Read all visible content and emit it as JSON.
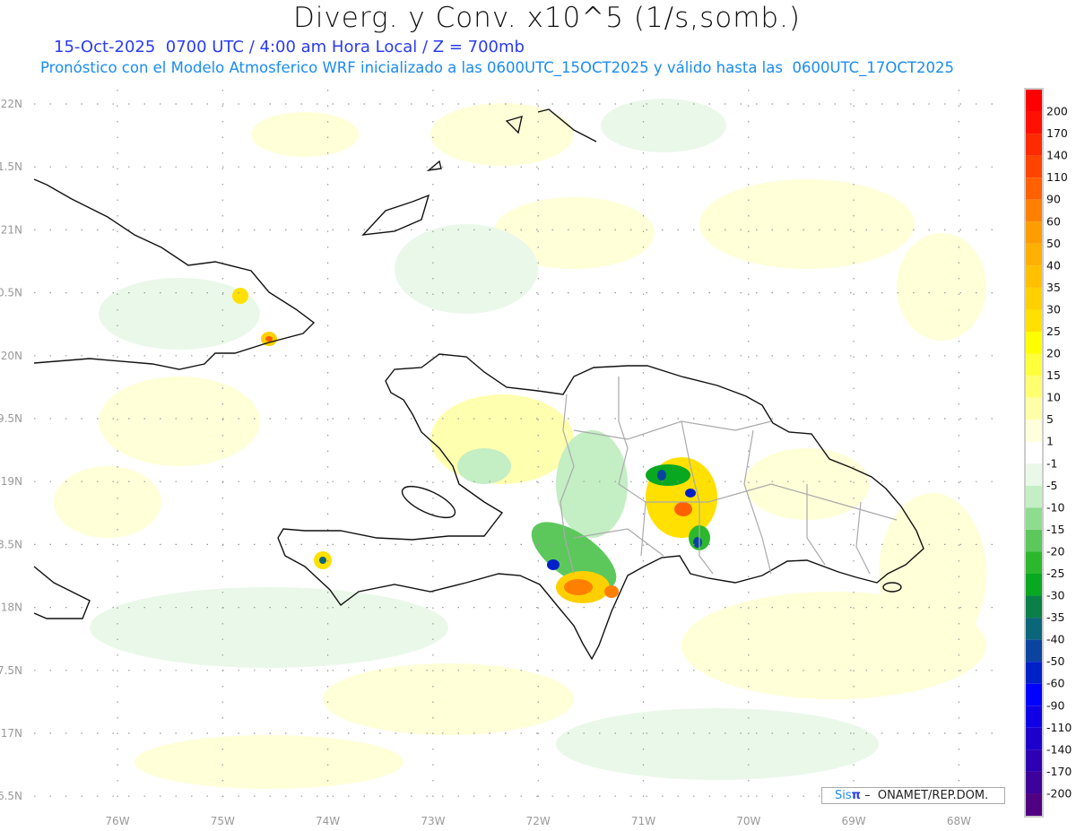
{
  "header": {
    "title": "Diverg. y Conv. x10^5 (1/s,somb.)",
    "subtitle": "15-Oct-2025  0700 UTC / 4:00 am Hora Local / Z = 700mb",
    "model_info": "Pronóstico con el Modelo Atmosferico WRF inicializado a las 0600UTC_15OCT2025 y válido hasta las  0600UTC_17OCT2025"
  },
  "map": {
    "lon_labels": [
      "76W",
      "75W",
      "74W",
      "73W",
      "72W",
      "71W",
      "70W",
      "69W",
      "68W"
    ],
    "lat_labels": [
      "22N",
      "1.5N",
      "21N",
      "0.5N",
      "20N",
      "9.5N",
      "19N",
      "8.5N",
      "18N",
      "7.5N",
      "17N",
      "6.5N"
    ]
  },
  "colorbar": {
    "labels": [
      "200",
      "170",
      "140",
      "110",
      "90",
      "60",
      "50",
      "40",
      "35",
      "30",
      "25",
      "20",
      "15",
      "10",
      "5",
      "1",
      "-1",
      "-5",
      "-10",
      "-15",
      "-20",
      "-25",
      "-30",
      "-35",
      "-40",
      "-50",
      "-60",
      "-90",
      "-110",
      "-140",
      "-170",
      "-200"
    ],
    "colors": [
      "#ff0000",
      "#ff1000",
      "#ff2a00",
      "#ff4400",
      "#ff6000",
      "#ff8000",
      "#ff9c00",
      "#ffb000",
      "#ffc000",
      "#ffd000",
      "#ffe000",
      "#ffff00",
      "#ffff3c",
      "#ffff70",
      "#ffffa8",
      "#ffffdc",
      "#ffffff",
      "#eaf8ea",
      "#c4eec4",
      "#8edc8e",
      "#5cc85c",
      "#2cb82c",
      "#08a820",
      "#0a8048",
      "#0a6678",
      "#0a44a0",
      "#0020c8",
      "#0000ff",
      "#1000e6",
      "#1e00cc",
      "#2e00b4",
      "#3e009a",
      "#500082"
    ]
  },
  "credit": {
    "sis": "Sis",
    "pi": "π",
    "text": " –  ONAMET/REP.DOM."
  }
}
